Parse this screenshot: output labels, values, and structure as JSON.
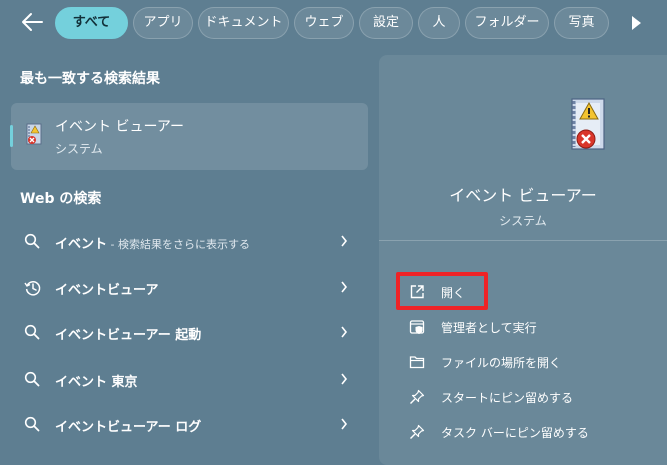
{
  "filters": {
    "tabs": [
      {
        "label": "すべて",
        "active": true
      },
      {
        "label": "アプリ"
      },
      {
        "label": "ドキュメント"
      },
      {
        "label": "ウェブ"
      },
      {
        "label": "設定"
      },
      {
        "label": "人"
      },
      {
        "label": "フォルダー"
      },
      {
        "label": "写真"
      }
    ]
  },
  "best_match": {
    "heading": "最も一致する検索結果",
    "title": "イベント ビューアー",
    "subtitle": "システム"
  },
  "web": {
    "heading": "Web の検索",
    "items": [
      {
        "icon": "search-icon",
        "bold": "イベント",
        "rest": " - 検索結果をさらに表示する"
      },
      {
        "icon": "history-icon",
        "bold": "イベントビューア",
        "rest": ""
      },
      {
        "icon": "search-icon",
        "bold": "イベントビューアー 起動",
        "rest": ""
      },
      {
        "icon": "search-icon",
        "bold": "イベント 東京",
        "rest": ""
      },
      {
        "icon": "search-icon",
        "bold": "イベントビューアー ログ",
        "rest": ""
      }
    ]
  },
  "details": {
    "title": "イベント ビューアー",
    "subtitle": "システム",
    "actions": [
      {
        "icon": "open-external-icon",
        "label": "開く"
      },
      {
        "icon": "admin-shield-icon",
        "label": "管理者として実行"
      },
      {
        "icon": "folder-icon",
        "label": "ファイルの場所を開く"
      },
      {
        "icon": "pin-icon",
        "label": "スタートにピン留めする"
      },
      {
        "icon": "pin-icon",
        "label": "タスク バーにピン留めする"
      }
    ]
  },
  "colors": {
    "background": "#5e7e91",
    "panel": "#6a8899",
    "active_chip": "#74d0dc",
    "highlight_box": "#ee2326"
  }
}
